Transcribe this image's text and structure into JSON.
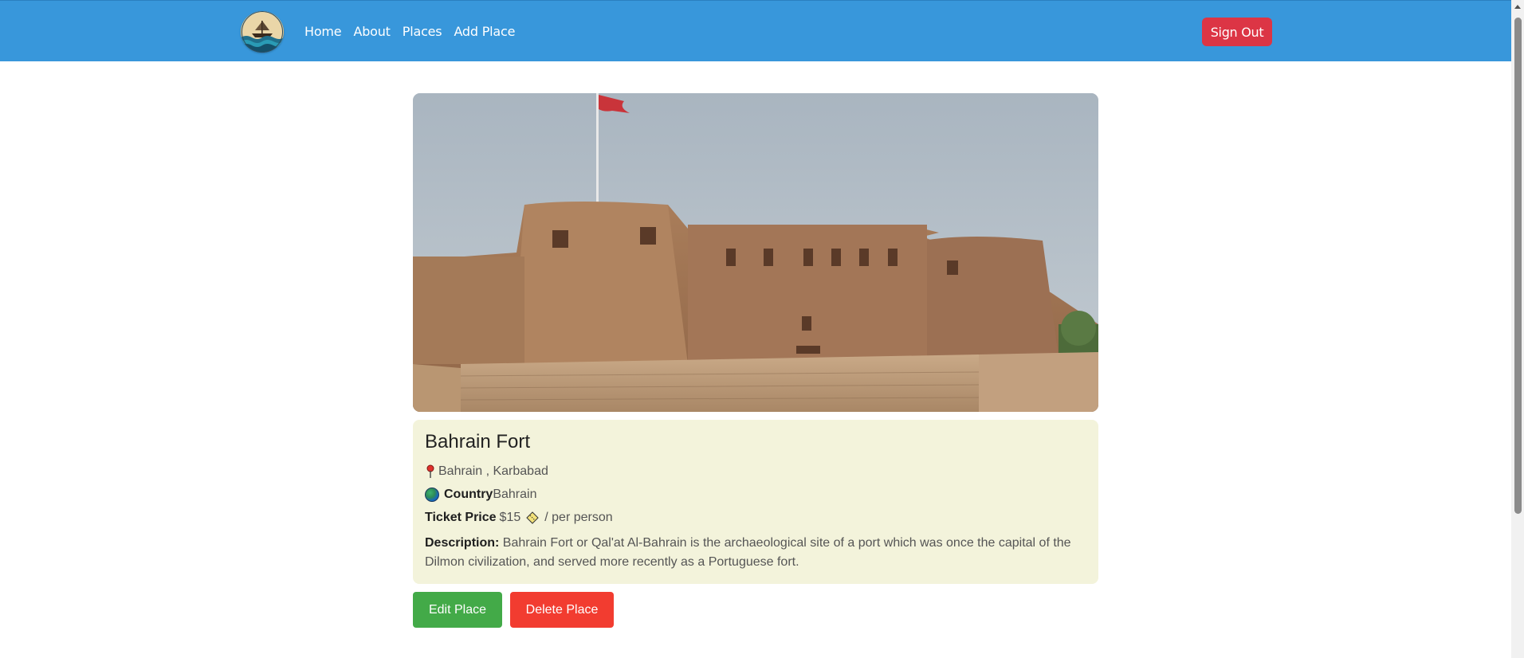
{
  "nav": {
    "logo_icon": "ship-logo-icon",
    "links": [
      "Home",
      "About",
      "Places",
      "Add Place"
    ],
    "signout_label": "Sign Out"
  },
  "place": {
    "image_icon": "fort-photo",
    "name": "Bahrain Fort",
    "location_icon": "pin-icon",
    "location": "Bahrain , Karbabad",
    "country_icon": "globe-icon",
    "country_label": "Country",
    "country_value": "Bahrain",
    "ticket_label": "Ticket Price",
    "ticket_price": "$15",
    "ticket_icon": "ticket-icon",
    "ticket_unit": "/ per person",
    "description_label": "Description:",
    "description": "Bahrain Fort or Qal'at Al-Bahrain is the archaeological site of a port which was once the capital of the Dilmon civilization, and served more recently as a Portuguese fort."
  },
  "actions": {
    "edit_label": "Edit Place",
    "delete_label": "Delete Place"
  },
  "colors": {
    "navbar": "#3897db",
    "signout": "#dc3545",
    "card": "#f3f3db",
    "edit": "#43aa48",
    "delete": "#f23c30"
  }
}
